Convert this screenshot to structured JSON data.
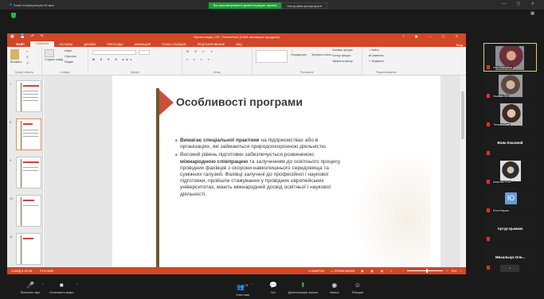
{
  "zoom": {
    "window_title": "Zoom Конференция 40 мин",
    "banner_text": "Вы просматриваете демонстрацию экрана",
    "banner_options": "Настройки просмотра ▾"
  },
  "ppt": {
    "title": "Презентация_ОП - PowerPoint (Сбой активации продукта)",
    "tabs": [
      "ФАЙЛ",
      "ГЛАВНАЯ",
      "ВСТАВКА",
      "ДИЗАЙН",
      "ПЕРЕХОДЫ",
      "АНИМАЦИЯ",
      "ПОКАЗ СЛАЙДОВ",
      "РЕЦЕНЗИРОВАНИЕ",
      "ВИД"
    ],
    "active_tab_index": 1,
    "login": "Вход",
    "ribbon": {
      "clipboard_label": "Буфер обмена",
      "paste": "Вставить",
      "slides_label": "Слайды",
      "create_slide": "Создать слайд",
      "layout": "Макет",
      "reset": "Сбросить",
      "section": "Раздел",
      "font_label": "Шрифт",
      "paragraph_label": "Абзац",
      "drawing_label": "Рисование",
      "arrange": "Упорядочить",
      "quick_styles": "Экспресс-стили",
      "shape_fill": "Заливка фигуры",
      "shape_outline": "Контур фигуры",
      "shape_effects": "Эффекты фигур",
      "editing_label": "Редактирование",
      "find": "Найти",
      "replace": "Заменить",
      "select": "Выделить"
    },
    "slide_numbers": [
      "7",
      "8",
      "9",
      "10",
      "11"
    ],
    "slide": {
      "title": "Особливості програми",
      "bullet1_bold": "Вимагає спеціальної практики",
      "bullet1_rest": " на підприємствах або в організаціях, які займаються природоохоронною діяльністю.",
      "bullet2_pre": "Високий рівень підготовки забезпечується розвиненою ",
      "bullet2_bold": "міжнародною співпрацею",
      "bullet2_rest": " та залученням до освітнього процесу провідних фахівців з охорони навколишнього середовища та суміжних галузей. Фахівці залучені до професійної і наукової підготовки, пройшли стажування у провідних європейських університетах, мають міжнародний досвід освітньої і наукової діяльності."
    },
    "status": {
      "slide_counter": "СЛАЙД 8 ИЗ 38",
      "language": "РУССКИЙ",
      "notes": "ЗАМЕТКИ",
      "comments": "ПРИМЕЧАНИЯ",
      "zoom": "75%"
    }
  },
  "participants": [
    {
      "name": "Істр Плитубов",
      "kind": "video"
    },
    {
      "name": "Ільинко Тет",
      "kind": "video"
    },
    {
      "name": "Тетяна Югай",
      "kind": "video"
    },
    {
      "name": "Вова Кошовий",
      "kind": "name"
    },
    {
      "name": "Анастас н Ол",
      "kind": "video"
    },
    {
      "name": "Юля Наулко",
      "kind": "avatar",
      "initial": "Ю"
    },
    {
      "name": "Артур Цымкик",
      "kind": "name"
    },
    {
      "name": "Михальчук Оле...",
      "kind": "name"
    }
  ],
  "toolbar": {
    "mic": "Включить звук",
    "video": "Остановить видео",
    "participants": "Участники",
    "participants_count": "21",
    "chat": "Чат",
    "share": "Демонстрация экрана",
    "record": "Запись",
    "reactions": "Реакции"
  },
  "colors": {
    "ppt_accent": "#d24726",
    "zoom_green": "#1f9e3a",
    "slide_accent": "#c8513a"
  }
}
